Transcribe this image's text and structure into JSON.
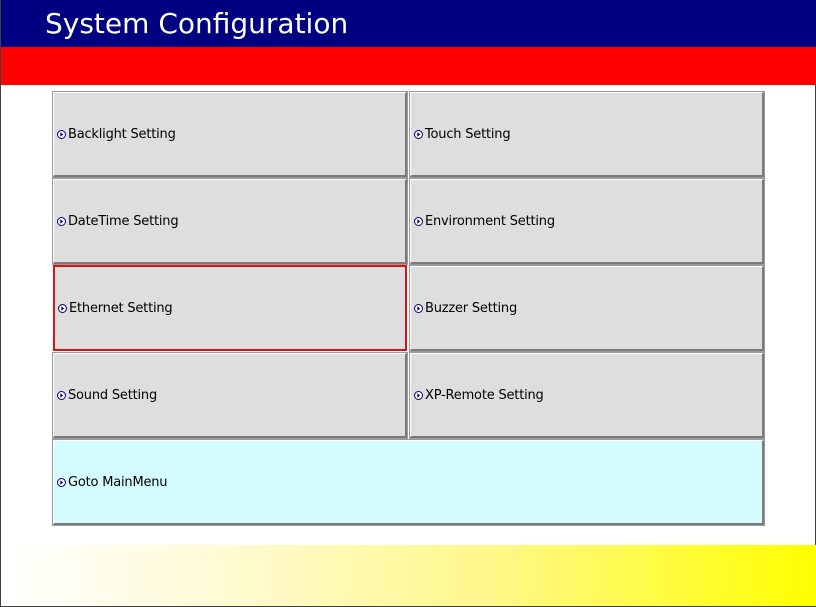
{
  "title_bar": {
    "title": "System Configuration"
  },
  "colors": {
    "title_bg": "#000080",
    "accent_red": "#ff0000",
    "button_bg": "#dedede",
    "main_menu_bg": "#d4fbfd",
    "selection_border": "#e01010",
    "footer_gradient_end": "#ffff00"
  },
  "menu": {
    "items": [
      {
        "label": "Backlight Setting",
        "icon": "arrow-right-circle-icon"
      },
      {
        "label": "Touch Setting",
        "icon": "arrow-right-circle-icon"
      },
      {
        "label": "DateTime Setting",
        "icon": "arrow-right-circle-icon"
      },
      {
        "label": "Environment Setting",
        "icon": "arrow-right-circle-icon"
      },
      {
        "label": "Ethernet Setting",
        "icon": "arrow-right-circle-icon",
        "selected": true
      },
      {
        "label": "Buzzer Setting",
        "icon": "arrow-right-circle-icon"
      },
      {
        "label": "Sound Setting",
        "icon": "arrow-right-circle-icon"
      },
      {
        "label": "XP-Remote Setting",
        "icon": "arrow-right-circle-icon"
      }
    ],
    "main_menu": {
      "label": "Goto MainMenu",
      "icon": "arrow-right-circle-icon"
    }
  }
}
